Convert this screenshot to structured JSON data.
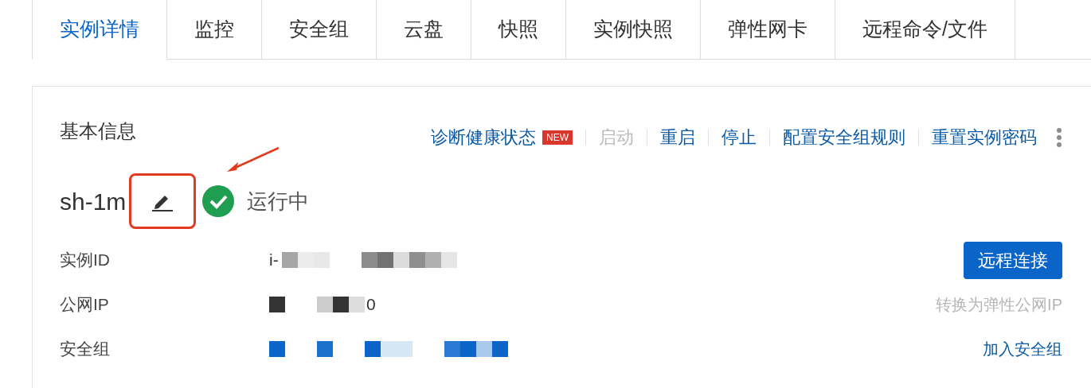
{
  "tabs": [
    {
      "label": "实例详情",
      "selected": true
    },
    {
      "label": "监控",
      "selected": false
    },
    {
      "label": "安全组",
      "selected": false
    },
    {
      "label": "云盘",
      "selected": false
    },
    {
      "label": "快照",
      "selected": false
    },
    {
      "label": "实例快照",
      "selected": false
    },
    {
      "label": "弹性网卡",
      "selected": false
    },
    {
      "label": "远程命令/文件",
      "selected": false
    }
  ],
  "card": {
    "title": "基本信息",
    "actions": [
      {
        "label": "诊断健康状态",
        "badge": "NEW",
        "disabled": false
      },
      {
        "label": "启动",
        "disabled": true
      },
      {
        "label": "重启",
        "disabled": false
      },
      {
        "label": "停止",
        "disabled": false
      },
      {
        "label": "配置安全组规则",
        "disabled": false
      },
      {
        "label": "重置实例密码",
        "disabled": false
      }
    ],
    "instance": {
      "name": "sh-1m",
      "status": "运行中",
      "running": true,
      "annotated": true
    },
    "rows": [
      {
        "label": "实例ID",
        "kind": "id",
        "value_prefix": "i-",
        "side": {
          "kind": "button",
          "text": "远程连接"
        }
      },
      {
        "label": "公网IP",
        "kind": "ip",
        "value_suffix": "0",
        "side": {
          "kind": "disabled-link",
          "text": "转换为弹性公网IP"
        }
      },
      {
        "label": "安全组",
        "kind": "group",
        "side": {
          "kind": "link",
          "text": "加入安全组"
        }
      }
    ]
  }
}
